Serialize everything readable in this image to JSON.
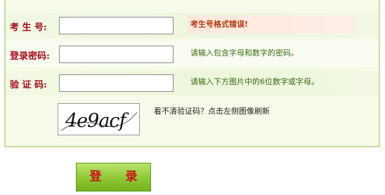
{
  "form": {
    "candidate_no": {
      "label": "考 生 号:",
      "value": "",
      "tip": "考生号格式错误!"
    },
    "password": {
      "label": "登录密码:",
      "value": "",
      "tip": "请输入包含字母和数字的密码。"
    },
    "verify_code": {
      "label": "验 证 码:",
      "value": "",
      "tip": "请输入下方图片中的6位数字或字母。"
    },
    "captcha": {
      "text": "4e9acf",
      "hint": "看不清验证码？点击左侧图像刷新"
    }
  },
  "login_button": {
    "label": "登 录"
  }
}
